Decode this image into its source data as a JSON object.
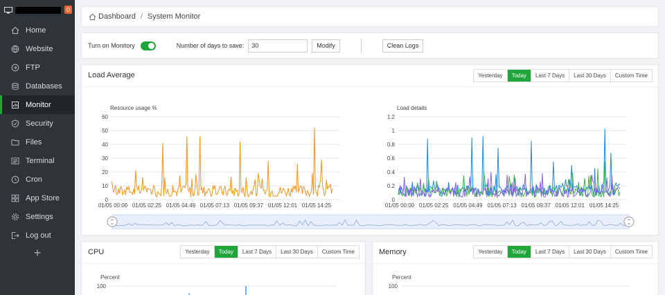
{
  "sidebar": {
    "badge": "0",
    "items": [
      {
        "label": "Home",
        "icon": "home-icon"
      },
      {
        "label": "Website",
        "icon": "globe-icon"
      },
      {
        "label": "FTP",
        "icon": "ftp-icon"
      },
      {
        "label": "Databases",
        "icon": "database-icon"
      },
      {
        "label": "Monitor",
        "icon": "monitor-icon"
      },
      {
        "label": "Security",
        "icon": "shield-icon"
      },
      {
        "label": "Files",
        "icon": "folder-icon"
      },
      {
        "label": "Terminal",
        "icon": "terminal-icon"
      },
      {
        "label": "Cron",
        "icon": "clock-icon"
      },
      {
        "label": "App Store",
        "icon": "grid-icon"
      },
      {
        "label": "Settings",
        "icon": "gear-icon"
      },
      {
        "label": "Log out",
        "icon": "logout-icon"
      }
    ],
    "add_label": "+"
  },
  "breadcrumb": {
    "home": "Dashboard",
    "sep": "/",
    "current": "System Monitor"
  },
  "controls": {
    "monitor_label": "Turn on Monitory",
    "monitor_on": true,
    "days_label": "Number of days to save:",
    "days_value": "30",
    "modify": "Modify",
    "clean_logs": "Clean Logs"
  },
  "tabs": {
    "yesterday": "Yesterday",
    "today": "Today",
    "last7": "Last 7 Days",
    "last30": "Last 30 Days",
    "custom": "Custom Time"
  },
  "load": {
    "title": "Load Average"
  },
  "cpu": {
    "title": "CPU",
    "ylabel": "Percent",
    "ytop": "100"
  },
  "memory": {
    "title": "Memory",
    "ylabel": "Percent",
    "ytop": "100"
  },
  "colors": {
    "accent": "#20a53a",
    "orange": "#f7931e",
    "blue": "#1a8ae0",
    "green": "#3bb34a",
    "purple": "#8a5cf6"
  },
  "chart_data": [
    {
      "type": "line",
      "title": "",
      "ylabel": "Resource usage %",
      "ylim": [
        0,
        60
      ],
      "yticks": [
        "0",
        "10",
        "20",
        "30",
        "40",
        "50",
        "60"
      ],
      "xticks": [
        "01/05 00:00",
        "01/05 02:25",
        "01/05 04:49",
        "01/05 07:13",
        "01/05 09:37",
        "01/05 12:01",
        "01/05 14:25"
      ],
      "series": [
        {
          "color": "#f7931e",
          "peaks": [
            [
              0.23,
              41
            ],
            [
              0.34,
              46
            ],
            [
              0.4,
              46
            ],
            [
              0.58,
              42
            ],
            [
              0.71,
              28
            ],
            [
              0.84,
              26
            ],
            [
              0.92,
              52
            ],
            [
              0.95,
              29
            ]
          ],
          "baseline": 7
        }
      ]
    },
    {
      "type": "line",
      "title": "",
      "ylabel": "Load details",
      "ylim": [
        0,
        1.2
      ],
      "yticks": [
        "0",
        "0.2",
        "0.4",
        "0.6",
        "0.8",
        "1",
        "1.2"
      ],
      "xticks": [
        "01/05 00:00",
        "01/05 02:25",
        "01/05 04:49",
        "01/05 07:13",
        "01/05 09:37",
        "01/05 12:01",
        "01/05 14:25"
      ],
      "series": [
        {
          "color": "#1a8ae0",
          "peaks": [
            [
              0.13,
              0.88
            ],
            [
              0.33,
              0.9
            ],
            [
              0.38,
              0.92
            ],
            [
              0.45,
              0.75
            ],
            [
              0.6,
              0.85
            ],
            [
              0.7,
              0.55
            ],
            [
              0.78,
              0.5
            ],
            [
              0.93,
              1.03
            ],
            [
              0.96,
              0.68
            ]
          ],
          "baseline": 0.15
        },
        {
          "color": "#3bb34a",
          "peaks": [
            [
              0.93,
              0.55
            ],
            [
              0.9,
              0.45
            ]
          ],
          "baseline": 0.12
        },
        {
          "color": "#8a5cf6",
          "peaks": [
            [
              0.94,
              0.32
            ]
          ],
          "baseline": 0.12
        }
      ]
    }
  ]
}
